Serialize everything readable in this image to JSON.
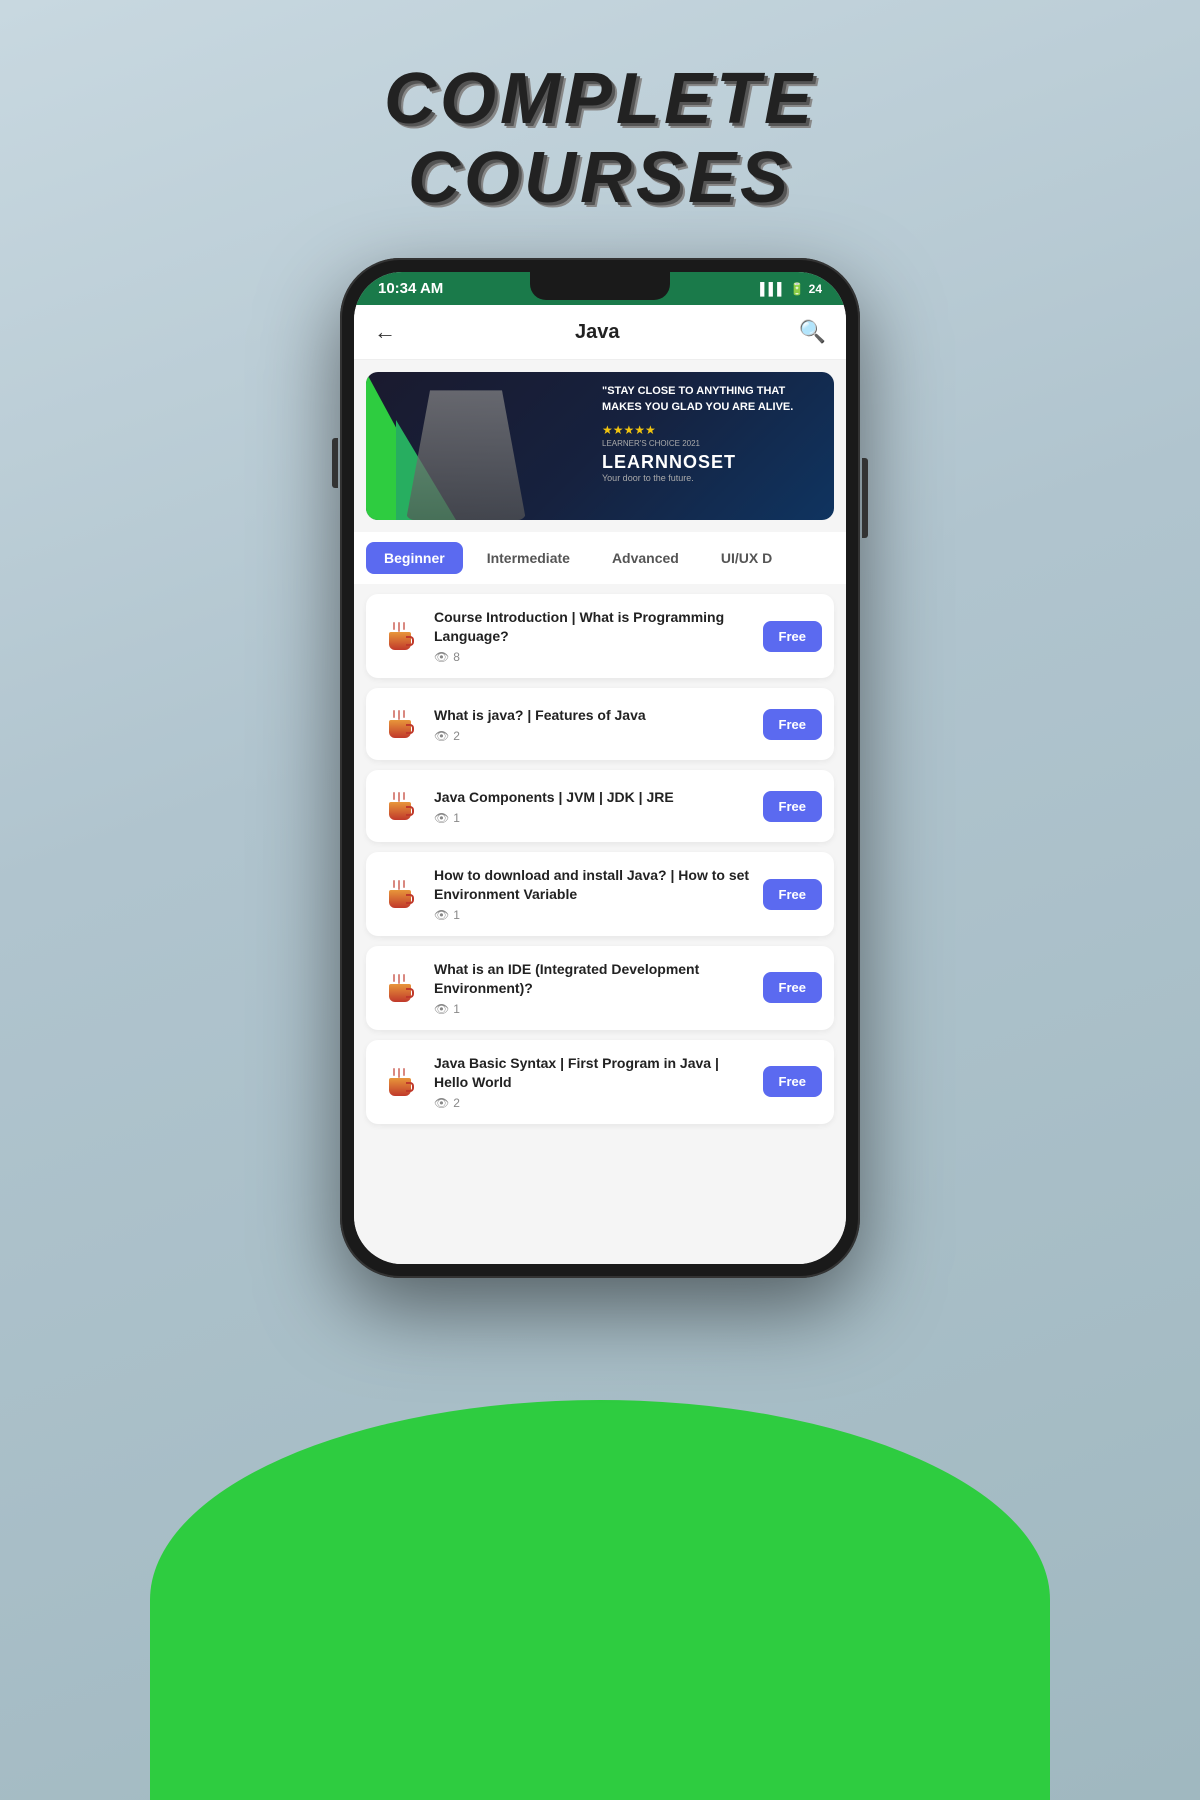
{
  "page": {
    "title_line1": "COMPLETE",
    "title_line2": "COURSES"
  },
  "status_bar": {
    "time": "10:34 AM",
    "battery": "24",
    "signal": "▌▌▌"
  },
  "header": {
    "back_label": "←",
    "title": "Java",
    "search_label": "🔍"
  },
  "banner": {
    "quote": "\"STAY CLOSE TO ANYTHING\nTHAT MAKES YOU GLAD YOU\nARE ALIVE.",
    "stars": "★★★★★",
    "choice": "LEARNER'S CHOICE 2021",
    "logo_part1": "LEARN",
    "logo_part2": "NO",
    "logo_part3": "SET",
    "tagline": "Your door to the future."
  },
  "tabs": [
    {
      "label": "Beginner",
      "active": true
    },
    {
      "label": "Intermediate",
      "active": false
    },
    {
      "label": "Advanced",
      "active": false
    },
    {
      "label": "UI/UX D",
      "active": false
    }
  ],
  "courses": [
    {
      "title": "Course Introduction | What is Programming Language?",
      "views": 8,
      "badge": "Free"
    },
    {
      "title": "What is java? | Features of Java",
      "views": 2,
      "badge": "Free"
    },
    {
      "title": "Java Components | JVM | JDK | JRE",
      "views": 1,
      "badge": "Free"
    },
    {
      "title": "How to download and install Java? | How to set Environment Variable",
      "views": 1,
      "badge": "Free"
    },
    {
      "title": "What is an IDE (Integrated Development Environment)?",
      "views": 1,
      "badge": "Free"
    },
    {
      "title": "Java Basic Syntax | First Program in Java | Hello World",
      "views": 2,
      "badge": "Free"
    }
  ]
}
